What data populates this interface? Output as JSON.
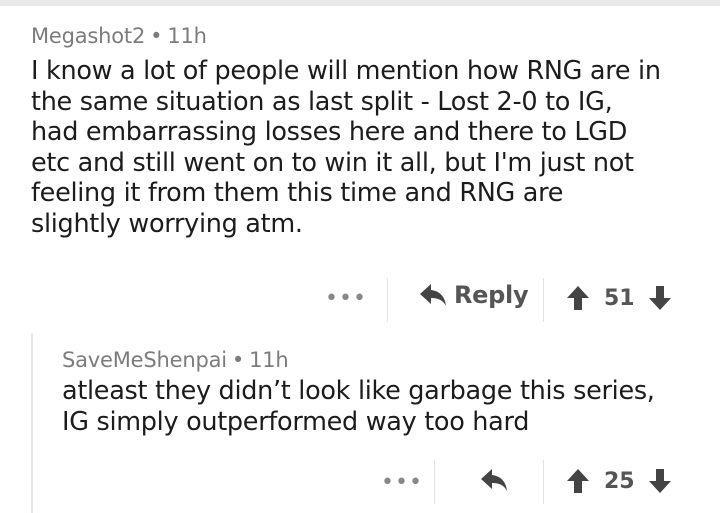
{
  "comment1": {
    "author": "Megashot2",
    "separator": "•",
    "time": "11h",
    "lines": [
      "I know a lot of people will mention how RNG are in",
      "the same situation as last split - Lost 2-0 to IG,",
      "had embarrassing losses here and there to LGD",
      "etc and still went on to win it all, but I'm just not",
      "feeling it from them this time and RNG are",
      "slightly worrying atm."
    ],
    "more_label": "•••",
    "reply_label": "Reply",
    "score": "51",
    "icons": [
      "more-icon",
      "reply-arrow-icon",
      "upvote-icon",
      "downvote-icon"
    ]
  },
  "comment2": {
    "author": "SaveMeShenpai",
    "separator": "•",
    "time": "11h",
    "lines": [
      "atleast they didn’t look like garbage this series,",
      "IG simply outperformed way too hard"
    ],
    "more_label": "•••",
    "score": "25",
    "icons": [
      "more-icon",
      "reply-arrow-icon",
      "upvote-icon",
      "downvote-icon"
    ]
  },
  "colors": {
    "text": "#1c1c1c",
    "meta": "#7c7c7c",
    "action": "#555555",
    "divider": "#e2e2e2"
  }
}
